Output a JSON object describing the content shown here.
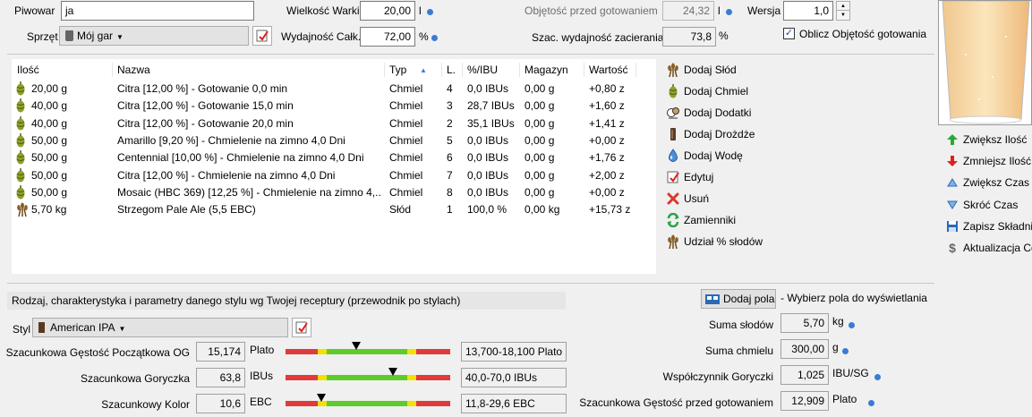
{
  "header": {
    "brewer_label": "Piwowar",
    "brewer_value": "ja",
    "equipment_label": "Sprzęt",
    "equipment_value": "Mój gar",
    "batch_size_label": "Wielkość Warki",
    "batch_size_value": "20,00",
    "batch_size_unit": "l",
    "efficiency_label": "Wydajność Całk.",
    "efficiency_value": "72,00",
    "efficiency_unit": "%",
    "preboil_label": "Objętość przed gotowaniem",
    "preboil_value": "24,32",
    "preboil_unit": "l",
    "mash_eff_label": "Szac. wydajność zacierania",
    "mash_eff_value": "73,8",
    "mash_eff_unit": "%",
    "version_label": "Wersja",
    "version_value": "1,0",
    "calc_preboil_label": "Oblicz Objętość gotowania",
    "calc_preboil_checked": true
  },
  "table": {
    "columns": [
      "Ilość",
      "Nazwa",
      "Typ",
      "L.",
      "%/IBU",
      "Magazyn",
      "Wartość"
    ],
    "rows": [
      {
        "icon": "hop-icon",
        "amount": "20,00 g",
        "name": "Citra [12,00 %] - Gotowanie 0,0 min",
        "type": "Chmiel",
        "num": "4",
        "ibu": "0,0 IBUs",
        "stock": "0,00 g",
        "value": "+0,80 z"
      },
      {
        "icon": "hop-icon",
        "amount": "40,00 g",
        "name": "Citra [12,00 %] - Gotowanie 15,0 min",
        "type": "Chmiel",
        "num": "3",
        "ibu": "28,7 IBUs",
        "stock": "0,00 g",
        "value": "+1,60 z"
      },
      {
        "icon": "hop-icon",
        "amount": "40,00 g",
        "name": "Citra [12,00 %] - Gotowanie 20,0 min",
        "type": "Chmiel",
        "num": "2",
        "ibu": "35,1 IBUs",
        "stock": "0,00 g",
        "value": "+1,41 z"
      },
      {
        "icon": "hop-icon",
        "amount": "50,00 g",
        "name": "Amarillo [9,20 %] - Chmielenie na zimno 4,0 Dni",
        "type": "Chmiel",
        "num": "5",
        "ibu": "0,0 IBUs",
        "stock": "0,00 g",
        "value": "+0,00 z"
      },
      {
        "icon": "hop-icon",
        "amount": "50,00 g",
        "name": "Centennial [10,00 %] - Chmielenie na zimno 4,0 Dni",
        "type": "Chmiel",
        "num": "6",
        "ibu": "0,0 IBUs",
        "stock": "0,00 g",
        "value": "+1,76 z"
      },
      {
        "icon": "hop-icon",
        "amount": "50,00 g",
        "name": "Citra [12,00 %] - Chmielenie na zimno 4,0 Dni",
        "type": "Chmiel",
        "num": "7",
        "ibu": "0,0 IBUs",
        "stock": "0,00 g",
        "value": "+2,00 z"
      },
      {
        "icon": "hop-icon",
        "amount": "50,00 g",
        "name": "Mosaic (HBC 369) [12,25 %] - Chmielenie na zimno 4,...",
        "type": "Chmiel",
        "num": "8",
        "ibu": "0,0 IBUs",
        "stock": "0,00 g",
        "value": "+0,00 z"
      },
      {
        "icon": "grain-icon",
        "amount": "5,70 kg",
        "name": "Strzegom Pale Ale (5,5 EBC)",
        "type": "Słód",
        "num": "1",
        "ibu": "100,0 %",
        "stock": "0,00 kg",
        "value": "+15,73 z"
      }
    ]
  },
  "actions": [
    {
      "name": "add-grain",
      "icon": "grain-icon",
      "label": "Dodaj Słód"
    },
    {
      "name": "add-hop",
      "icon": "hop-icon",
      "label": "Dodaj Chmiel"
    },
    {
      "name": "add-misc",
      "icon": "misc-icon",
      "label": "Dodaj Dodatki"
    },
    {
      "name": "add-yeast",
      "icon": "yeast-icon",
      "label": "Dodaj Drożdże"
    },
    {
      "name": "add-water",
      "icon": "water-drop-icon",
      "label": "Dodaj Wodę"
    },
    {
      "name": "edit",
      "icon": "edit-icon",
      "label": "Edytuj"
    },
    {
      "name": "delete",
      "icon": "delete-icon",
      "label": "Usuń"
    },
    {
      "name": "substitutes",
      "icon": "swap-icon",
      "label": "Zamienniki"
    },
    {
      "name": "grain-percent",
      "icon": "grain-icon",
      "label": "Udział % słodów"
    }
  ],
  "actions2": [
    {
      "name": "increase-amount",
      "icon": "arrow-up-icon",
      "label": "Zwiększ Ilość"
    },
    {
      "name": "decrease-amount",
      "icon": "arrow-down-icon",
      "label": "Zmniejsz Ilość"
    },
    {
      "name": "increase-time",
      "icon": "triangle-up-icon",
      "label": "Zwiększ Czas"
    },
    {
      "name": "shorten-time",
      "icon": "triangle-down-icon",
      "label": "Skróć Czas"
    },
    {
      "name": "save-ingredient",
      "icon": "save-icon",
      "label": "Zapisz Składnik"
    },
    {
      "name": "update-costs",
      "icon": "dollar-icon",
      "label": "Aktualizacja Ce"
    }
  ],
  "style": {
    "heading": "Rodzaj, charakterystyka i parametry danego stylu wg Twojej receptury (przewodnik po stylach)",
    "style_label": "Styl",
    "style_value": "American IPA",
    "gauges": [
      {
        "label": "Szacunkowa Gęstość Początkowa OG",
        "value": "15,174",
        "unit": "Plato",
        "range": "13,700-18,100 Plato",
        "marker": 0.43
      },
      {
        "label": "Szacunkowa Goryczka",
        "value": "63,8",
        "unit": "IBUs",
        "range": "40,0-70,0 IBUs",
        "marker": 0.65
      },
      {
        "label": "Szacunkowy Kolor",
        "value": "10,6",
        "unit": "EBC",
        "range": "11,8-29,6 EBC",
        "marker": 0.22
      }
    ]
  },
  "fields": {
    "add_button": "Dodaj pola",
    "add_hint": "- Wybierz pola do wyświetlania",
    "items": [
      {
        "label": "Suma słodów",
        "value": "5,70",
        "unit": "kg"
      },
      {
        "label": "Suma chmielu",
        "value": "300,00",
        "unit": "g"
      },
      {
        "label": "Współczynnik Goryczki",
        "value": "1,025",
        "unit": "IBU/SG"
      },
      {
        "label": "Szacunkowa Gęstość przed gotowaniem",
        "value": "12,909",
        "unit": "Plato"
      }
    ]
  },
  "colors": {
    "accent": "#3a7bd5",
    "gauge_red": "#e03a3a",
    "gauge_yellow": "#f2e200",
    "gauge_green": "#5ecb2a"
  }
}
